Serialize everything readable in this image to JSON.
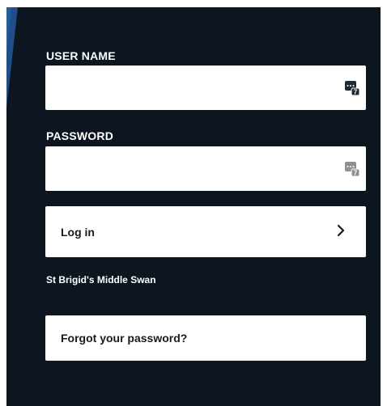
{
  "login_form": {
    "username": {
      "label": "USER NAME",
      "value": "",
      "placeholder": "",
      "icon": "password-manager-icon"
    },
    "password": {
      "label": "PASSWORD",
      "value": "",
      "placeholder": "",
      "icon": "password-manager-icon"
    },
    "login_button": {
      "label": "Log in",
      "icon": "chevron-right-icon"
    },
    "school_name": "St Brigid's Middle Swan",
    "forgot_button": {
      "label": "Forgot your password?"
    }
  },
  "colors": {
    "panel_background": "#0c1520",
    "accent_blue": "#1f4f86",
    "field_background": "#ffffff",
    "label_text": "#ffffff",
    "button_text": "#1a1a1a"
  }
}
